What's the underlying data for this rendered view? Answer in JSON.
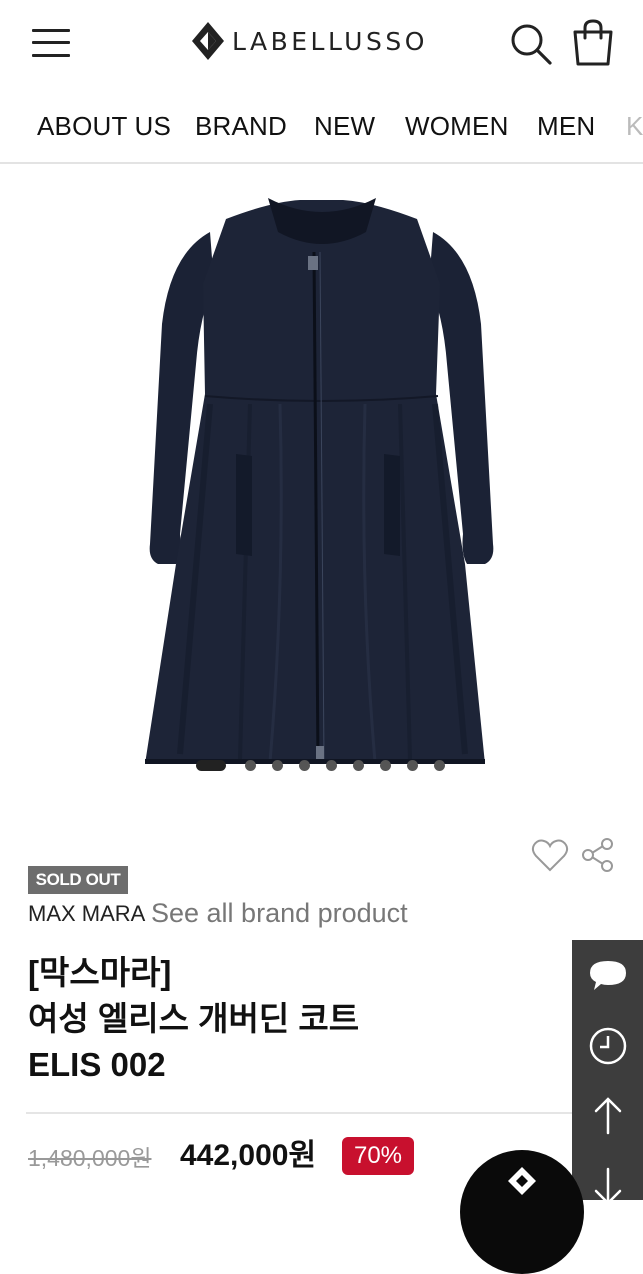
{
  "header": {
    "logo_text": "LABELLUSSO"
  },
  "nav": {
    "items": [
      "ABOUT US",
      "BRAND",
      "NEW",
      "WOMEN",
      "MEN",
      "K"
    ]
  },
  "product": {
    "image_alt": "Max Mara navy gabardine coat",
    "gallery_count": 9,
    "gallery_active_index": 0,
    "status_badge": "SOLD OUT",
    "brand": "MAX MARA",
    "brand_link": "See all brand product",
    "title_line1": "[막스마라]",
    "title_line2": "여성 엘리스 개버딘 코트",
    "title_line3": "ELIS 002",
    "original_price": "1,480,000원",
    "sale_price": "442,000원",
    "discount": "70%"
  },
  "colors": {
    "coat": "#1c2336",
    "soldout_badge": "#6d6d6d",
    "discount_badge": "#c8102e",
    "sidebar": "#3d3d3d"
  },
  "icons": {
    "menu": "hamburger-icon",
    "search": "search-icon",
    "cart": "shopping-bag-icon",
    "wish": "heart-icon",
    "share": "share-icon",
    "chat": "chat-bubble-icon",
    "history": "clock-icon",
    "top": "arrow-up-icon",
    "bottom": "arrow-down-icon"
  }
}
